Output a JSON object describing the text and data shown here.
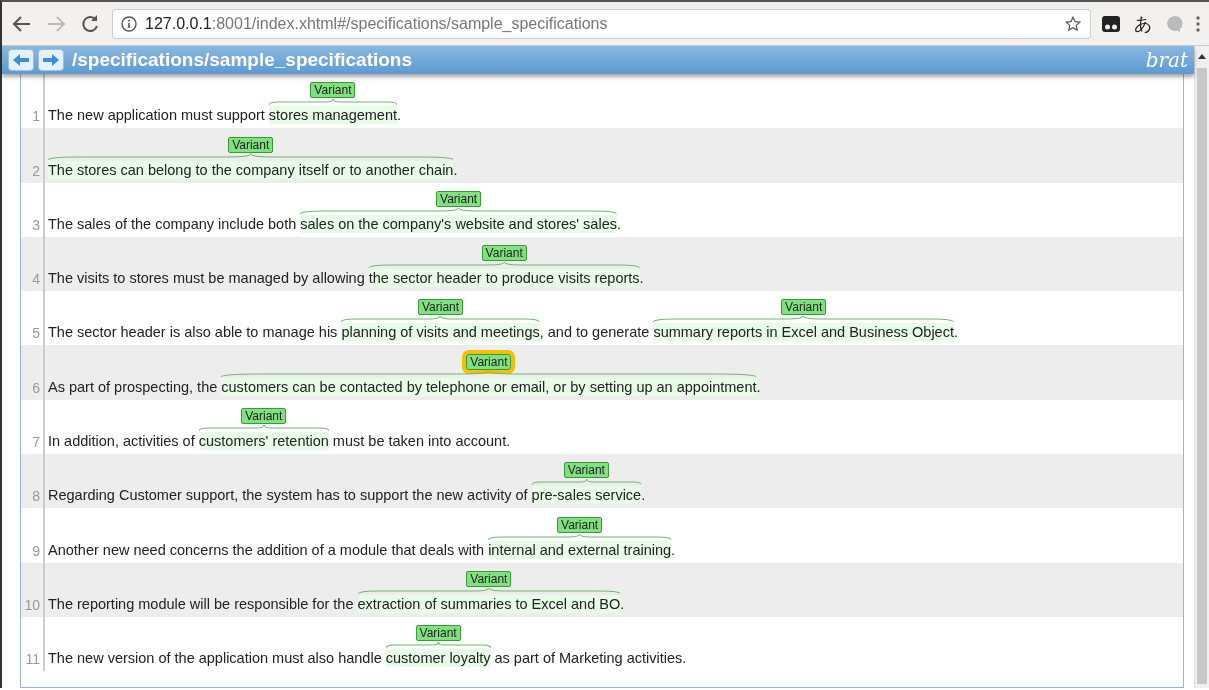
{
  "browser": {
    "url_host": "127.0.0.1",
    "url_rest": ":8001/index.xhtml#/specifications/sample_specifications",
    "extension_glyph": "あ"
  },
  "header": {
    "title": "/specifications/sample_specifications",
    "logo": "brat"
  },
  "sentences": [
    {
      "number": "1",
      "segments": [
        {
          "kind": "text",
          "text": "The new application must support "
        },
        {
          "kind": "span",
          "text": "stores management",
          "label": "Variant",
          "selected": false
        },
        {
          "kind": "text",
          "text": "."
        }
      ]
    },
    {
      "number": "2",
      "segments": [
        {
          "kind": "span",
          "text": "The stores can belong to the company itself or to another chain",
          "label": "Variant",
          "selected": false
        },
        {
          "kind": "text",
          "text": "."
        }
      ]
    },
    {
      "number": "3",
      "segments": [
        {
          "kind": "text",
          "text": "The sales of the company include both "
        },
        {
          "kind": "span",
          "text": "sales on the company's website and stores' sales",
          "label": "Variant",
          "selected": false
        },
        {
          "kind": "text",
          "text": "."
        }
      ]
    },
    {
      "number": "4",
      "segments": [
        {
          "kind": "text",
          "text": "The visits to stores must be managed by allowing "
        },
        {
          "kind": "span",
          "text": "the sector header to produce visits reports",
          "label": "Variant",
          "selected": false
        },
        {
          "kind": "text",
          "text": "."
        }
      ]
    },
    {
      "number": "5",
      "segments": [
        {
          "kind": "text",
          "text": "The sector header is also able to manage his "
        },
        {
          "kind": "span",
          "text": "planning of visits and meetings",
          "label": "Variant",
          "selected": false
        },
        {
          "kind": "text",
          "text": ", and to generate "
        },
        {
          "kind": "span",
          "text": "summary reports in Excel and Business Object",
          "label": "Variant",
          "selected": false
        },
        {
          "kind": "text",
          "text": "."
        }
      ]
    },
    {
      "number": "6",
      "segments": [
        {
          "kind": "text",
          "text": "As part of prospecting, the "
        },
        {
          "kind": "span",
          "text": "customers can be contacted by telephone or email, or by setting up an appointment",
          "label": "Variant",
          "selected": true
        },
        {
          "kind": "text",
          "text": "."
        }
      ]
    },
    {
      "number": "7",
      "segments": [
        {
          "kind": "text",
          "text": "In addition, activities of "
        },
        {
          "kind": "span",
          "text": "customers' retention",
          "label": "Variant",
          "selected": false
        },
        {
          "kind": "text",
          "text": " must be taken into account."
        }
      ]
    },
    {
      "number": "8",
      "segments": [
        {
          "kind": "text",
          "text": "Regarding Customer support, the system has to support the new activity of "
        },
        {
          "kind": "span",
          "text": "pre-sales service",
          "label": "Variant",
          "selected": false
        },
        {
          "kind": "text",
          "text": "."
        }
      ]
    },
    {
      "number": "9",
      "segments": [
        {
          "kind": "text",
          "text": "Another new need concerns the addition of a module that deals with "
        },
        {
          "kind": "span",
          "text": "internal and external training",
          "label": "Variant",
          "selected": false
        },
        {
          "kind": "text",
          "text": "."
        }
      ]
    },
    {
      "number": "10",
      "segments": [
        {
          "kind": "text",
          "text": "The reporting module will be responsible for the "
        },
        {
          "kind": "span",
          "text": "extraction of summaries to Excel and BO",
          "label": "Variant",
          "selected": false
        },
        {
          "kind": "text",
          "text": "."
        }
      ]
    },
    {
      "number": "11",
      "segments": [
        {
          "kind": "text",
          "text": "The new version of the application must also handle "
        },
        {
          "kind": "span",
          "text": "customer loyalty",
          "label": "Variant",
          "selected": false
        },
        {
          "kind": "text",
          "text": " as part of Marketing activities."
        }
      ]
    }
  ]
}
